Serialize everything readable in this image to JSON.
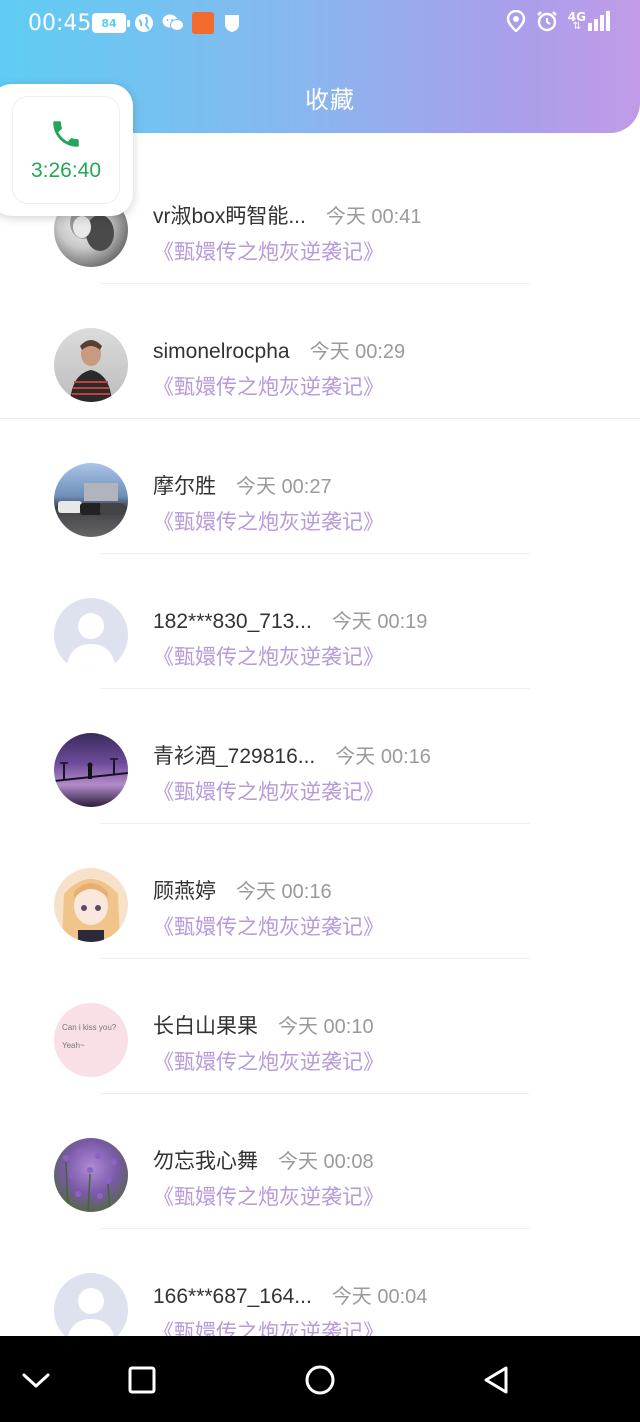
{
  "status_bar": {
    "time": "00:45",
    "battery": "84",
    "network": "4G",
    "icons_left": [
      "battery-icon",
      "globe-icon",
      "wechat-icon",
      "mail-app-icon",
      "shield-icon"
    ],
    "icons_right": [
      "location-icon",
      "alarm-icon",
      "signal-icon"
    ]
  },
  "header": {
    "title": "收藏",
    "gradient": [
      "#5fcdf3",
      "#c19be8"
    ]
  },
  "call": {
    "timer": "3:26:40",
    "color": "#22a75a"
  },
  "items": [
    {
      "name": "vr淑box眄智能...",
      "time": "今天 00:41",
      "book": "《甄嬛传之炮灰逆袭记》",
      "avatar": "bw-couple-photo"
    },
    {
      "name": "simonelrocpha",
      "time": "今天 00:29",
      "book": "《甄嬛传之炮灰逆袭记》",
      "avatar": "man-striped-shirt-photo"
    },
    {
      "name": "摩尔胜",
      "time": "今天 00:27",
      "book": "《甄嬛传之炮灰逆袭记》",
      "avatar": "cars-photo"
    },
    {
      "name": "182***830_713...",
      "time": "今天 00:19",
      "book": "《甄嬛传之炮灰逆袭记》",
      "avatar": "default-avatar"
    },
    {
      "name": "青衫酒_729816...",
      "time": "今天 00:16",
      "book": "《甄嬛传之炮灰逆袭记》",
      "avatar": "purple-night-photo"
    },
    {
      "name": "顾燕婷",
      "time": "今天 00:16",
      "book": "《甄嬛传之炮灰逆袭记》",
      "avatar": "anime-girl-photo"
    },
    {
      "name": "长白山果果",
      "time": "今天 00:10",
      "book": "《甄嬛传之炮灰逆袭记》",
      "avatar": "pink-text-avatar",
      "avatar_text": [
        "Can i kiss you?",
        "Yeah~"
      ]
    },
    {
      "name": "勿忘我心舞",
      "time": "今天 00:08",
      "book": "《甄嬛传之炮灰逆袭记》",
      "avatar": "lavender-photo"
    },
    {
      "name": "166***687_164...",
      "time": "今天 00:04",
      "book": "《甄嬛传之炮灰逆袭记》",
      "avatar": "default-avatar"
    }
  ],
  "colors": {
    "book_title": "#b79ad9",
    "time_text": "#9a9a9a",
    "name_text": "#333333"
  },
  "navbar": {
    "buttons": [
      "back-chevron-icon",
      "recents-icon",
      "home-icon",
      "back-triangle-icon"
    ]
  }
}
